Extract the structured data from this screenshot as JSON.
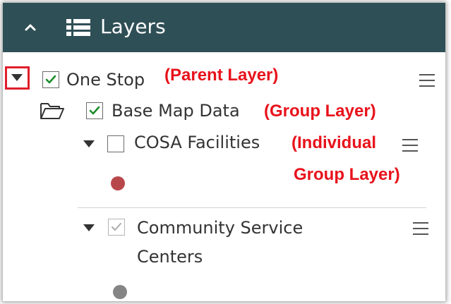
{
  "panel": {
    "title": "Layers",
    "header_color": "#2f4f56"
  },
  "layers": {
    "one_stop": {
      "label": "One Stop",
      "checked": true,
      "annotation": "(Parent Layer)"
    },
    "base_map_data": {
      "label": "Base Map Data",
      "checked": true,
      "annotation": "(Group Layer)"
    },
    "cosa_facilities": {
      "label": "COSA Facilities",
      "checked": false,
      "annotation_line1": "(Individual",
      "annotation_line2": "Group Layer)",
      "symbol_color": "#b8474c"
    },
    "community_service_centers": {
      "label_line1": "Community Service",
      "label_line2": "Centers",
      "checked": true,
      "symbol_color": "#858585"
    }
  },
  "colors": {
    "annotation": "#e8121b",
    "highlight_box": "#e01e2b",
    "check_green": "#1e8c2c"
  },
  "icons": [
    "chevron-up-icon",
    "layer-list-icon",
    "expand-triangle-icon",
    "folder-icon",
    "menu-icon",
    "checkbox-icon"
  ]
}
